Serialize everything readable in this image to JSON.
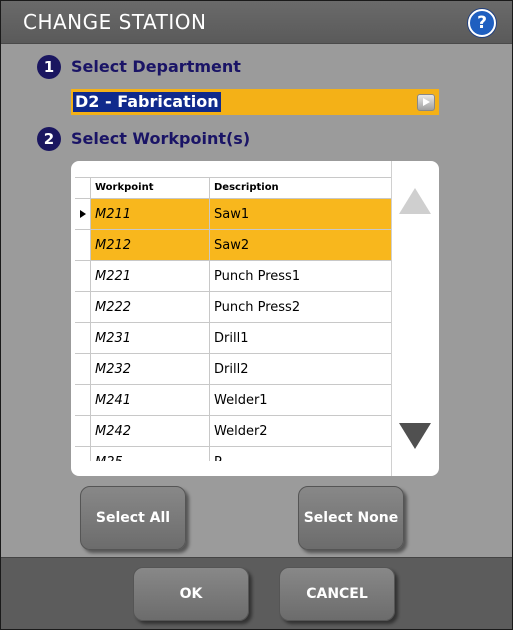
{
  "window": {
    "title": "CHANGE STATION",
    "help_label": "?"
  },
  "department": {
    "step_number": "1",
    "label": "Select Department",
    "selected_value": "D2 - Fabrication"
  },
  "workpoints": {
    "step_number": "2",
    "label": "Select Workpoint(s)",
    "columns": [
      "Workpoint",
      "Description"
    ],
    "rows": [
      {
        "workpoint": "M211",
        "description": "Saw1",
        "selected": true,
        "current": true
      },
      {
        "workpoint": "M212",
        "description": "Saw2",
        "selected": true,
        "current": false
      },
      {
        "workpoint": "M221",
        "description": "Punch Press1",
        "selected": false,
        "current": false
      },
      {
        "workpoint": "M222",
        "description": "Punch Press2",
        "selected": false,
        "current": false
      },
      {
        "workpoint": "M231",
        "description": "Drill1",
        "selected": false,
        "current": false
      },
      {
        "workpoint": "M232",
        "description": "Drill2",
        "selected": false,
        "current": false
      },
      {
        "workpoint": "M241",
        "description": "Welder1",
        "selected": false,
        "current": false
      },
      {
        "workpoint": "M242",
        "description": "Welder2",
        "selected": false,
        "current": false
      },
      {
        "workpoint": "M25",
        "description": "P",
        "selected": false,
        "current": false
      }
    ]
  },
  "buttons": {
    "select_all": "Select All",
    "select_none": "Select None",
    "ok": "OK",
    "cancel": "CANCEL"
  },
  "colors": {
    "selection": "#f8b71d",
    "label_text": "#1a1466",
    "dropdown_bg": "#f4b117",
    "dropdown_highlight": "#102a8c"
  }
}
